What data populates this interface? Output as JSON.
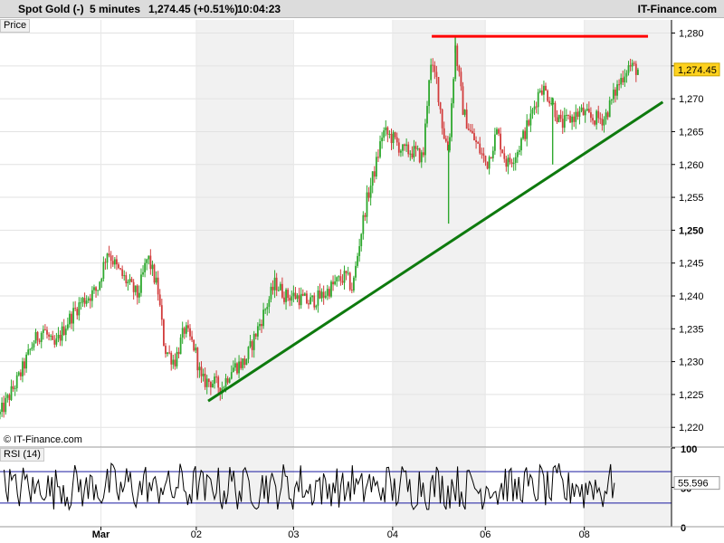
{
  "header": {
    "instrument": "Spot Gold (-)",
    "interval": "5 minutes",
    "price_change": "1,274.45 (+0.51%)",
    "time": "10:04:23",
    "brand": "IT-Finance.com"
  },
  "panels": {
    "price_label": "Price",
    "rsi_label": "RSI (14)",
    "watermark": "© IT-Finance.com"
  },
  "colors": {
    "up_candle": "#2ea82e",
    "down_candle": "#d23c3c",
    "trend_support": "#0e7a0e",
    "resistance": "#ff0000",
    "rsi_line": "#000000",
    "rsi_bands": "#1a1aa0",
    "shade": "#f1f1f1"
  },
  "chart_data": [
    {
      "type": "candlestick",
      "title": "Spot Gold (-)",
      "ylim": [
        1217,
        1282
      ],
      "y_ticks": [
        {
          "value": 1280,
          "label": "1,280"
        },
        {
          "value": 1275,
          "label": "1,275"
        },
        {
          "value": 1270,
          "label": "1,270"
        },
        {
          "value": 1265,
          "label": "1,265"
        },
        {
          "value": 1260,
          "label": "1,260"
        },
        {
          "value": 1255,
          "label": "1,255"
        },
        {
          "value": 1250,
          "label": "1,250",
          "bold": true
        },
        {
          "value": 1245,
          "label": "1,245"
        },
        {
          "value": 1240,
          "label": "1,240"
        },
        {
          "value": 1235,
          "label": "1,235"
        },
        {
          "value": 1230,
          "label": "1,230"
        },
        {
          "value": 1225,
          "label": "1,225"
        },
        {
          "value": 1220,
          "label": "1,220"
        }
      ],
      "x_ticks": [
        {
          "pos": 0.1503,
          "label": "Mar",
          "bold": true
        },
        {
          "pos": 0.2923,
          "label": "02"
        },
        {
          "pos": 0.4372,
          "label": "03"
        },
        {
          "pos": 0.5847,
          "label": "04"
        },
        {
          "pos": 0.7227,
          "label": "06"
        },
        {
          "pos": 0.8702,
          "label": "08"
        }
      ],
      "shaded_sessions": [
        [
          0.2923,
          0.4372
        ],
        [
          0.5847,
          0.7227
        ],
        [
          0.8702,
          1.0
        ]
      ],
      "last_price": 1274.45,
      "last_price_label": "1,274.45",
      "trend_path": [
        [
          0.0,
          1222
        ],
        [
          0.015,
          1225
        ],
        [
          0.03,
          1228
        ],
        [
          0.05,
          1233
        ],
        [
          0.065,
          1235
        ],
        [
          0.08,
          1232
        ],
        [
          0.1,
          1236
        ],
        [
          0.12,
          1239
        ],
        [
          0.145,
          1241
        ],
        [
          0.16,
          1247
        ],
        [
          0.175,
          1244
        ],
        [
          0.19,
          1242
        ],
        [
          0.205,
          1240
        ],
        [
          0.22,
          1246
        ],
        [
          0.235,
          1241
        ],
        [
          0.245,
          1232
        ],
        [
          0.26,
          1230
        ],
        [
          0.275,
          1235
        ],
        [
          0.29,
          1232
        ],
        [
          0.3,
          1227
        ],
        [
          0.315,
          1227
        ],
        [
          0.33,
          1226
        ],
        [
          0.345,
          1229
        ],
        [
          0.365,
          1230
        ],
        [
          0.38,
          1234
        ],
        [
          0.395,
          1238
        ],
        [
          0.41,
          1242
        ],
        [
          0.425,
          1240
        ],
        [
          0.44,
          1240
        ],
        [
          0.46,
          1239
        ],
        [
          0.48,
          1240
        ],
        [
          0.5,
          1242
        ],
        [
          0.515,
          1243
        ],
        [
          0.525,
          1241
        ],
        [
          0.535,
          1248
        ],
        [
          0.545,
          1254
        ],
        [
          0.56,
          1260
        ],
        [
          0.57,
          1265
        ],
        [
          0.585,
          1264
        ],
        [
          0.6,
          1262
        ],
        [
          0.615,
          1262
        ],
        [
          0.63,
          1261
        ],
        [
          0.64,
          1275
        ],
        [
          0.65,
          1273
        ],
        [
          0.66,
          1265
        ],
        [
          0.668,
          1262
        ],
        [
          0.678,
          1278
        ],
        [
          0.69,
          1268
        ],
        [
          0.7,
          1265
        ],
        [
          0.71,
          1263
        ],
        [
          0.725,
          1260
        ],
        [
          0.74,
          1265
        ],
        [
          0.755,
          1260
        ],
        [
          0.77,
          1262
        ],
        [
          0.79,
          1267
        ],
        [
          0.805,
          1272
        ],
        [
          0.82,
          1270
        ],
        [
          0.835,
          1266
        ],
        [
          0.85,
          1267
        ],
        [
          0.865,
          1268
        ],
        [
          0.88,
          1267
        ],
        [
          0.9,
          1267
        ],
        [
          0.92,
          1272
        ],
        [
          0.935,
          1275
        ],
        [
          0.95,
          1274.45
        ]
      ],
      "spikes": [
        {
          "pos": 0.668,
          "low": 1251
        },
        {
          "pos": 0.678,
          "high": 1279.5
        },
        {
          "pos": 0.823,
          "low": 1260
        }
      ],
      "lines": [
        {
          "name": "support-trendline",
          "from": [
            0.31,
            1224
          ],
          "to": [
            0.987,
            1269.5
          ]
        },
        {
          "name": "resistance-line",
          "from": [
            0.643,
            1279.5
          ],
          "to": [
            0.965,
            1279.5
          ]
        }
      ]
    },
    {
      "type": "line",
      "title": "RSI (14)",
      "ylim": [
        0,
        100
      ],
      "y_ticks": [
        {
          "value": 100,
          "label": "100"
        },
        {
          "value": 50,
          "label": "50"
        },
        {
          "value": 0,
          "label": "0"
        }
      ],
      "bands": [
        70,
        30
      ],
      "last_value": 55.596,
      "last_value_label": "55.596"
    }
  ]
}
